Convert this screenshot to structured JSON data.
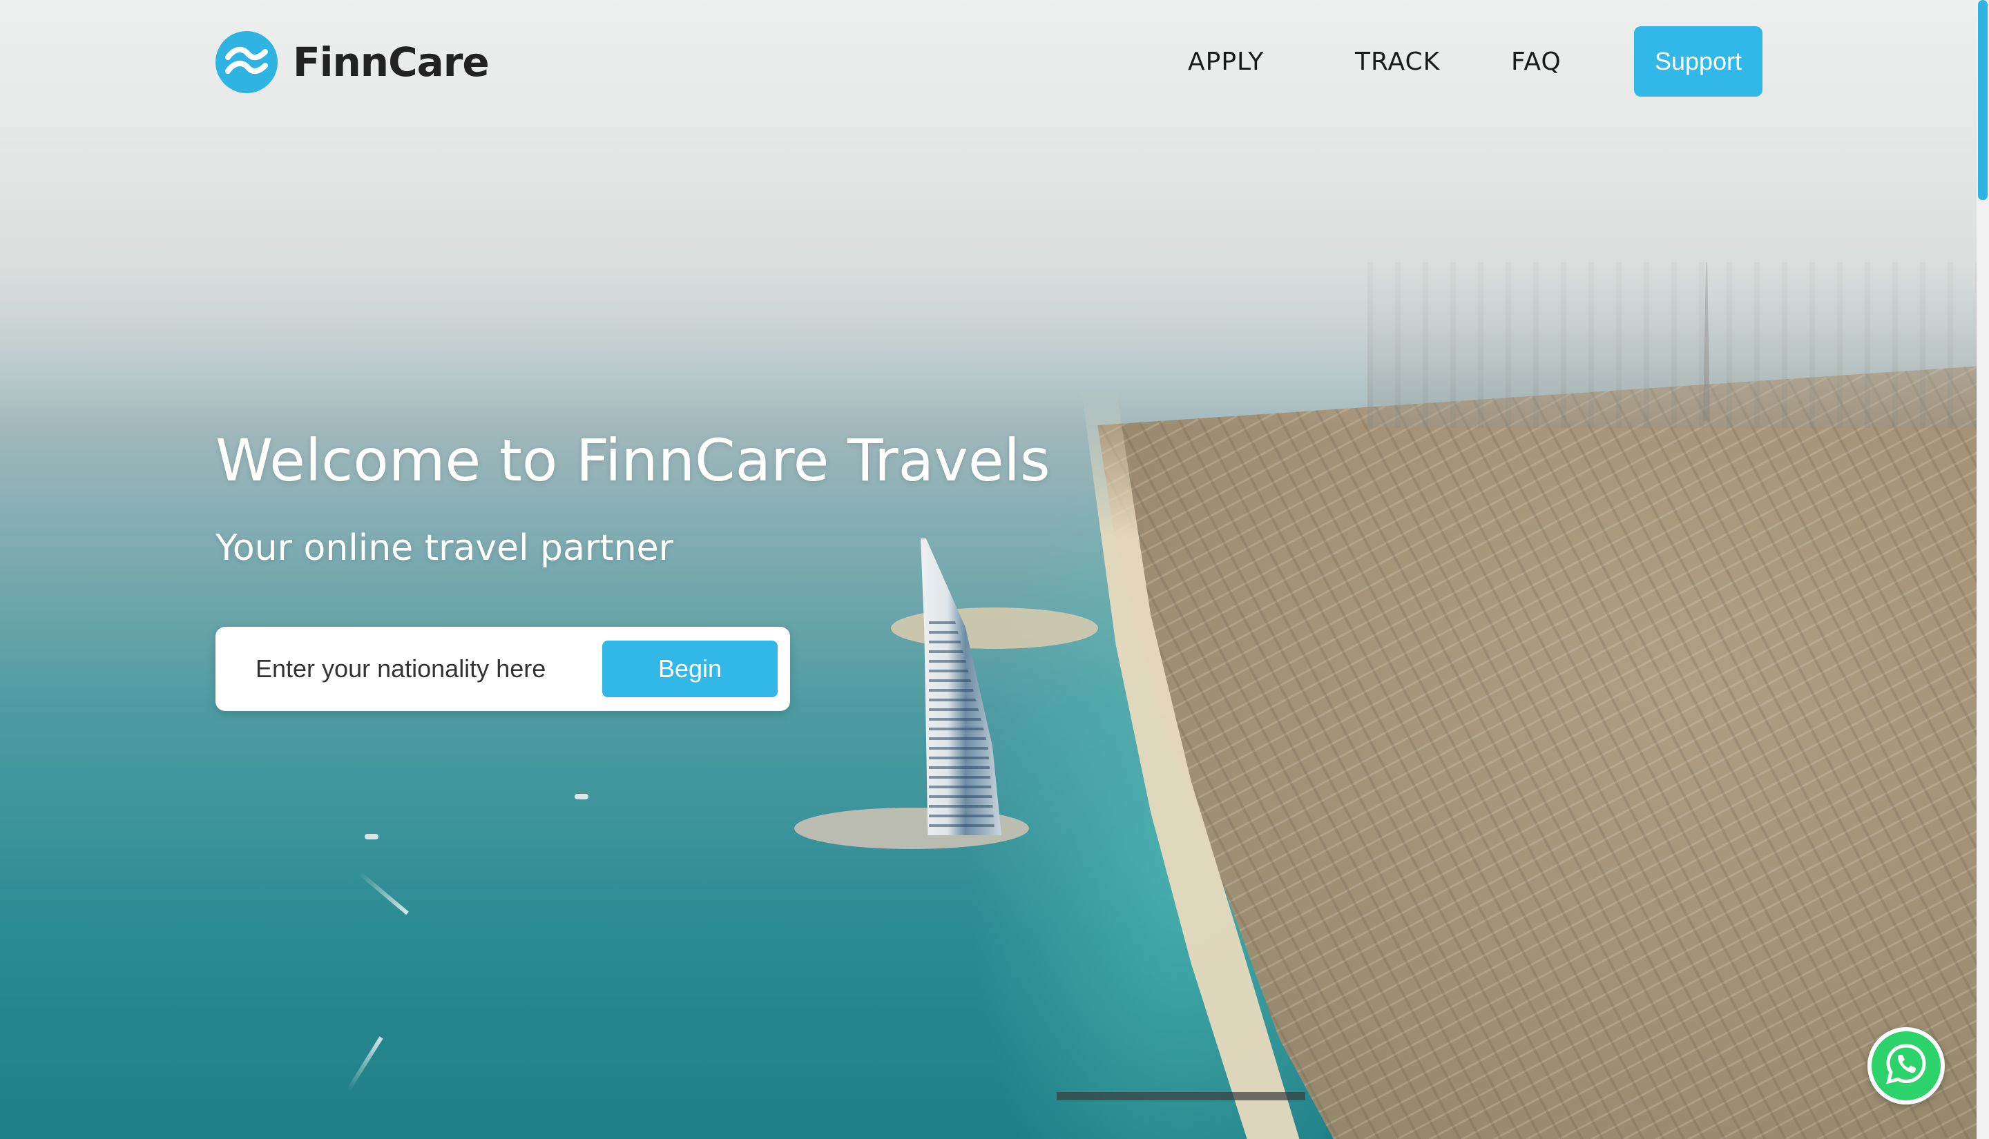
{
  "brand": {
    "name": "FinnCare",
    "accent_color": "#31b7e8",
    "logo_icon": "wave-logo-icon"
  },
  "nav": {
    "items": [
      {
        "label": "APPLY"
      },
      {
        "label": "TRACK"
      },
      {
        "label": "FAQ"
      }
    ],
    "support_label": "Support"
  },
  "hero": {
    "title": "Welcome to FinnCare Travels",
    "subtitle": "Your online travel partner",
    "background_image": "aerial-dubai-coastline"
  },
  "search": {
    "placeholder": "Enter your nationality here",
    "value": "",
    "button_label": "Begin"
  },
  "floating": {
    "whatsapp_icon": "whatsapp-icon",
    "whatsapp_color": "#2bd36a"
  }
}
